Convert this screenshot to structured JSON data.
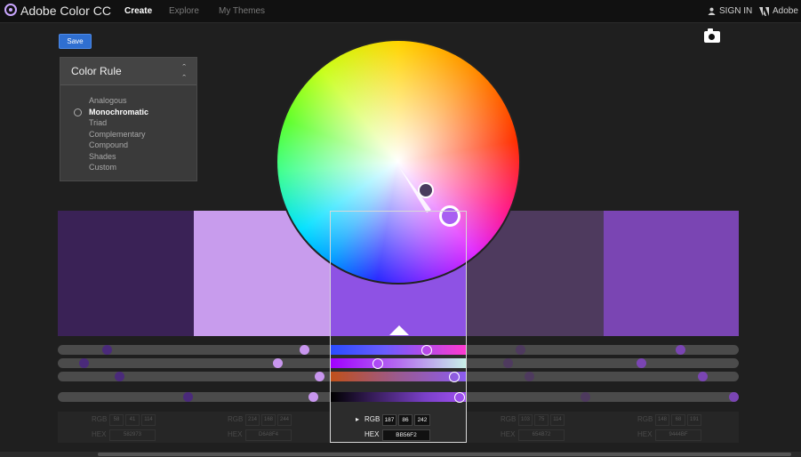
{
  "header": {
    "app_title": "Adobe Color CC",
    "nav": [
      "Create",
      "Explore",
      "My Themes"
    ],
    "sign_in": "SIGN IN",
    "adobe": "Adobe"
  },
  "toolbar": {
    "save_label": "Save"
  },
  "color_rule": {
    "title": "Color Rule",
    "options": [
      "Analogous",
      "Monochromatic",
      "Triad",
      "Complementary",
      "Compound",
      "Shades",
      "Custom"
    ],
    "selected": "Monochromatic"
  },
  "swatches": [
    {
      "hex": "#3a2256",
      "rgb": [
        "58",
        "41",
        "114"
      ],
      "hex_label": "582973"
    },
    {
      "hex": "#c89ced",
      "rgb": [
        "214",
        "168",
        "244"
      ],
      "hex_label": "D6A8F4"
    },
    {
      "hex": "#8e52e4",
      "rgb": [
        "187",
        "86",
        "242"
      ],
      "hex_label": "BB56F2"
    },
    {
      "hex": "#4e3a5e",
      "rgb": [
        "103",
        "75",
        "114"
      ],
      "hex_label": "654B72"
    },
    {
      "hex": "#7a45b3",
      "rgb": [
        "148",
        "68",
        "191"
      ],
      "hex_label": "9444BF"
    }
  ],
  "active_index": 2,
  "labels": {
    "rgb": "RGB",
    "hex": "HEX"
  },
  "colors": {
    "accent": "#2f6fd1",
    "base": "#bb56f2"
  }
}
